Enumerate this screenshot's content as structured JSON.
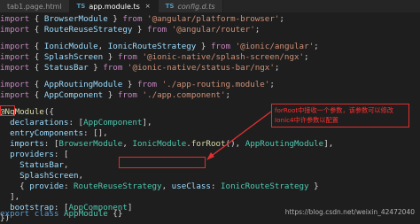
{
  "tabs": [
    {
      "badge": "",
      "label": "tab1.page.html",
      "active": false
    },
    {
      "badge": "TS",
      "label": "app.module.ts",
      "active": true,
      "close": "×"
    },
    {
      "badge": "TS",
      "label": "config.d.ts",
      "active": false
    }
  ],
  "code": {
    "l1": {
      "a": "import",
      "b": " { ",
      "c": "BrowserModule",
      "d": " } ",
      "e": "from",
      "f": " ",
      "g": "'@angular/platform-browser'",
      "h": ";"
    },
    "l2": {
      "a": "import",
      "b": " { ",
      "c": "RouteReuseStrategy",
      "d": " } ",
      "e": "from",
      "f": " ",
      "g": "'@angular/router'",
      "h": ";"
    },
    "l3": {
      "a": "import",
      "b": " { ",
      "c": "IonicModule",
      "d": ", ",
      "c2": "IonicRouteStrategy",
      "d2": " } ",
      "e": "from",
      "f": " ",
      "g": "'@ionic/angular'",
      "h": ";"
    },
    "l4": {
      "a": "import",
      "b": " { ",
      "c": "SplashScreen",
      "d": " } ",
      "e": "from",
      "f": " ",
      "g": "'@ionic-native/splash-screen/ngx'",
      "h": ";"
    },
    "l5": {
      "a": "import",
      "b": " { ",
      "c": "StatusBar",
      "d": " } ",
      "e": "from",
      "f": " ",
      "g": "'@ionic-native/status-bar/ngx'",
      "h": ";"
    },
    "l6": {
      "a": "import",
      "b": " { ",
      "c": "AppRoutingModule",
      "d": " } ",
      "e": "from",
      "f": " ",
      "g": "'./app-routing.module'",
      "h": ";"
    },
    "l7": {
      "a": "import",
      "b": " { ",
      "c": "AppComponent",
      "d": " } ",
      "e": "from",
      "f": " ",
      "g": "'./app.component'",
      "h": ";"
    },
    "l8": {
      "a": "@",
      "b": "NgModule",
      "c": "({"
    },
    "l9": {
      "a": "  declarations",
      "b": ": [",
      "c": "AppComponent",
      "d": "],"
    },
    "l10": {
      "a": "  entryComponents",
      "b": ": [],"
    },
    "l11": {
      "a": "  imports",
      "b": ": [",
      "c": "BrowserModule",
      "d": ", ",
      "e": "IonicModule",
      "f": ".",
      "g": "forRoot",
      "h": "(), ",
      "i": "AppRoutingModule",
      "j": "],"
    },
    "l12": {
      "a": "  providers",
      "b": ": ["
    },
    "l13": {
      "a": "    StatusBar",
      "b": ","
    },
    "l14": {
      "a": "    SplashScreen",
      "b": ","
    },
    "l15": {
      "a": "    { ",
      "b": "provide",
      "c": ": ",
      "d": "RouteReuseStrategy",
      "e": ", ",
      "f": "useClass",
      "g": ": ",
      "h": "IonicRouteStrategy",
      "i": " }"
    },
    "l16": {
      "a": "  ],"
    },
    "l17": {
      "a": "  bootstrap",
      "b": ": [",
      "c": "AppComponent",
      "d": "]"
    },
    "l18": {
      "a": "})"
    },
    "l19": {
      "a": "export",
      "b": " ",
      "c": "class",
      "d": " ",
      "e": "AppModule",
      "f": " {}"
    }
  },
  "annotation": {
    "line1": "forRoot中接收一个参数，该参数可以修改",
    "line2": "Ionic4中许参数以配置"
  },
  "colors": {
    "annotation": "#e03030",
    "background": "#1e1e1e"
  },
  "watermark": "https://blog.csdn.net/weixin_42472040"
}
